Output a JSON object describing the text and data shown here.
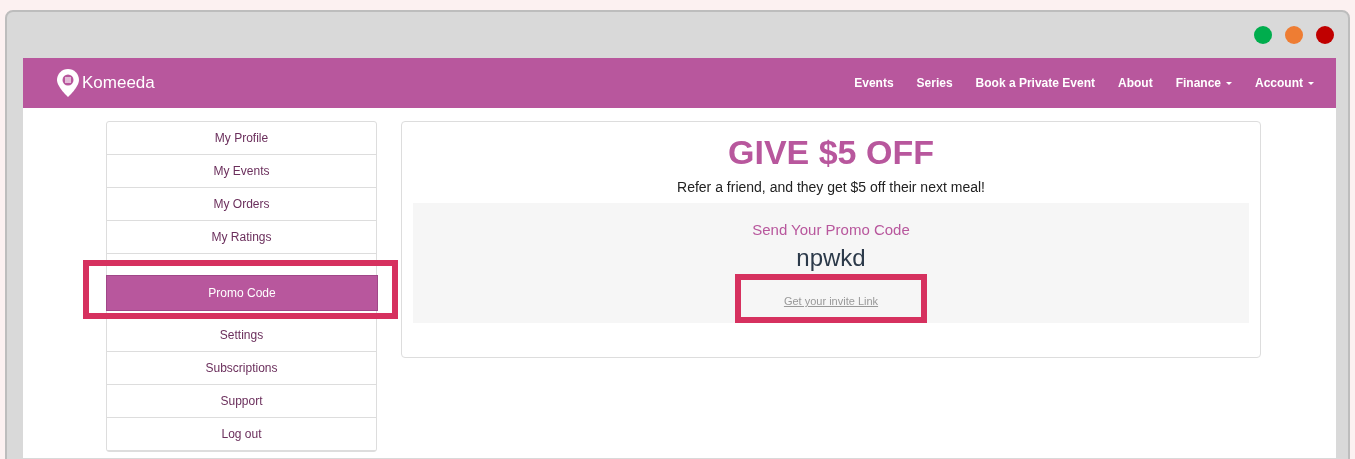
{
  "window": {
    "controls": [
      {
        "color": "#00ad4d"
      },
      {
        "color": "#ee7d33"
      },
      {
        "color": "#c00000"
      }
    ]
  },
  "navbar": {
    "brand": "Komeeda",
    "links": [
      {
        "label": "Events",
        "dropdown": false
      },
      {
        "label": "Series",
        "dropdown": false
      },
      {
        "label": "Book a Private Event",
        "dropdown": false
      },
      {
        "label": "About",
        "dropdown": false
      },
      {
        "label": "Finance",
        "dropdown": true
      },
      {
        "label": "Account",
        "dropdown": true
      }
    ]
  },
  "sidebar": {
    "items": [
      {
        "label": "My Profile",
        "selected": false,
        "highlighted": false
      },
      {
        "label": "My Events",
        "selected": false,
        "highlighted": false
      },
      {
        "label": "My Orders",
        "selected": false,
        "highlighted": false
      },
      {
        "label": "My Ratings",
        "selected": false,
        "highlighted": false
      },
      {
        "label": "Promo Code",
        "selected": true,
        "highlighted": true
      },
      {
        "label": "Settings",
        "selected": false,
        "highlighted": false
      },
      {
        "label": "Subscriptions",
        "selected": false,
        "highlighted": false
      },
      {
        "label": "Support",
        "selected": false,
        "highlighted": false
      },
      {
        "label": "Log out",
        "selected": false,
        "highlighted": false
      }
    ]
  },
  "promo": {
    "title": "GIVE $5 OFF",
    "subtitle": "Refer a friend, and they get $5 off their next meal!",
    "panel_heading": "Send Your Promo Code",
    "code": "npwkd",
    "invite_link": {
      "label": "Get your invite Link",
      "highlighted": true
    }
  }
}
